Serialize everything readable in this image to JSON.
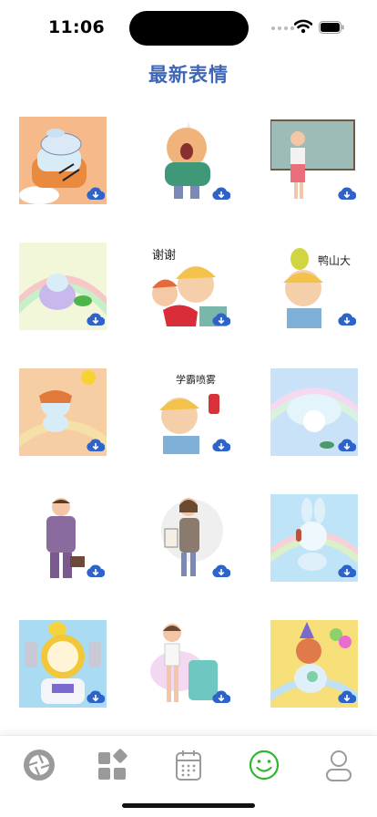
{
  "status_bar": {
    "time": "11:06"
  },
  "header": {
    "title": "最新表情"
  },
  "stickers": [
    {
      "name": "bunny-sleeping-on-sofa",
      "caption": ""
    },
    {
      "name": "monster-in-green-sweater",
      "caption": ""
    },
    {
      "name": "teacher-at-blackboard",
      "caption": ""
    },
    {
      "name": "bunny-with-caterpillar",
      "caption": ""
    },
    {
      "name": "couple-holding-heart",
      "caption": "谢谢"
    },
    {
      "name": "boy-with-pear-on-head",
      "caption": "鸭山大"
    },
    {
      "name": "bunny-running-with-hat",
      "caption": ""
    },
    {
      "name": "boy-with-spray",
      "caption": "学霸喷雾"
    },
    {
      "name": "bunny-under-jellyfish",
      "caption": ""
    },
    {
      "name": "businessman-with-briefcase",
      "caption": ""
    },
    {
      "name": "woman-holding-paper",
      "caption": ""
    },
    {
      "name": "bunny-with-headphones",
      "caption": ""
    },
    {
      "name": "bunny-astronaut",
      "caption": ""
    },
    {
      "name": "woman-with-suitcase",
      "caption": ""
    },
    {
      "name": "bunny-party-with-balloons",
      "caption": ""
    }
  ],
  "tab_bar": {
    "items": [
      {
        "id": "aperture",
        "icon": "aperture-icon",
        "active": false
      },
      {
        "id": "categories",
        "icon": "grid-icon",
        "active": false
      },
      {
        "id": "calendar",
        "icon": "calendar-icon",
        "active": false
      },
      {
        "id": "emoji",
        "icon": "smiley-icon",
        "active": true
      },
      {
        "id": "profile",
        "icon": "person-icon",
        "active": false
      }
    ]
  },
  "colors": {
    "title": "#3f66b7",
    "download_badge": "#2e63c9",
    "active_tab": "#2fb82f",
    "inactive_tab": "#9a9a9a"
  }
}
